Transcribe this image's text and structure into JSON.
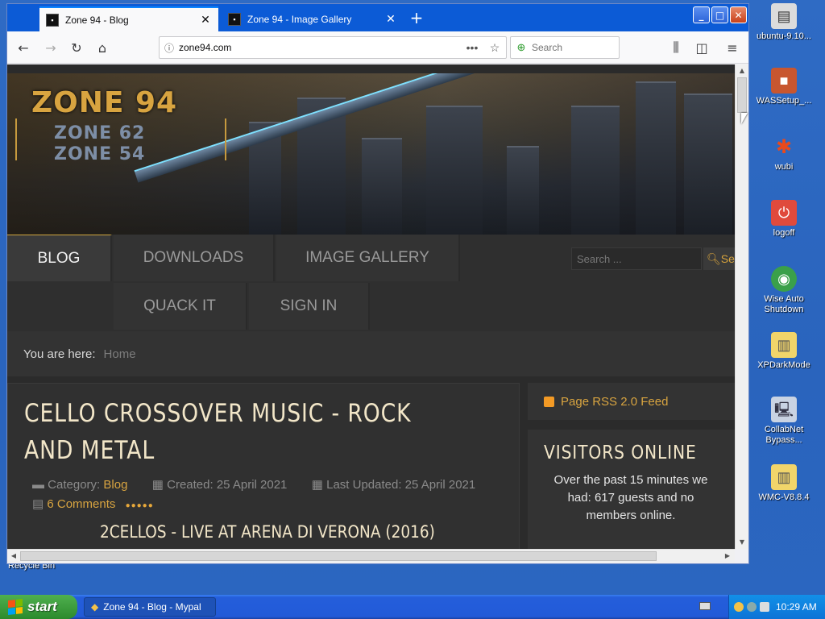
{
  "browser": {
    "tabs": [
      {
        "title": "Zone 94 - Blog",
        "active": true
      },
      {
        "title": "Zone 94 - Image Gallery",
        "active": false
      }
    ],
    "url": "zone94.com",
    "search_placeholder": "Search"
  },
  "site": {
    "logo": {
      "main": "ZONE 94",
      "line2": "ZONE 62",
      "line3": "ZONE 54"
    },
    "menu": [
      "BLOG",
      "DOWNLOADS",
      "IMAGE GALLERY",
      "QUACK IT",
      "SIGN IN"
    ],
    "search_placeholder": "Search ...",
    "search_button": "Se",
    "breadcrumb": {
      "label": "You are here:",
      "current": "Home"
    },
    "article": {
      "title": "CELLO CROSSOVER MUSIC - ROCK AND METAL",
      "category_label": "Category:",
      "category": "Blog",
      "created": "Created: 25 April 2021",
      "updated": "Last Updated: 25 April 2021",
      "comments": "6 Comments",
      "subheading": "2CELLOS - LIVE AT ARENA DI VERONA (2016)"
    },
    "rss_feed": "Page RSS 2.0 Feed",
    "visitors": {
      "title": "VISITORS ONLINE",
      "text": "Over the past 15 minutes we had: 617 guests and no members online."
    }
  },
  "desktop": {
    "icons": [
      {
        "label": "ubuntu-9.10...",
        "icon": "floppy-icon"
      },
      {
        "label": "WASSetup_...",
        "icon": "package-icon"
      },
      {
        "label": "wubi",
        "icon": "ubuntu-icon"
      },
      {
        "label": "logoff",
        "icon": "power-icon"
      },
      {
        "label": "Wise Auto Shutdown",
        "icon": "shutdown-icon"
      },
      {
        "label": "XPDarkMode",
        "icon": "zip-folder-icon"
      },
      {
        "label": "CollabNet Bypass...",
        "icon": "computer-icon"
      },
      {
        "label": "WMC-V8.8.4",
        "icon": "zip-folder-icon"
      }
    ],
    "recycle_bin": "Recycle Bin"
  },
  "taskbar": {
    "start_label": "start",
    "task": "Zone 94 - Blog - Mypal",
    "clock": "10:29 AM"
  },
  "colors": {
    "accent": "#d8a440",
    "titlebar": "#0c5bd6",
    "taskbar": "#245edb",
    "start": "#3c9a3c"
  }
}
